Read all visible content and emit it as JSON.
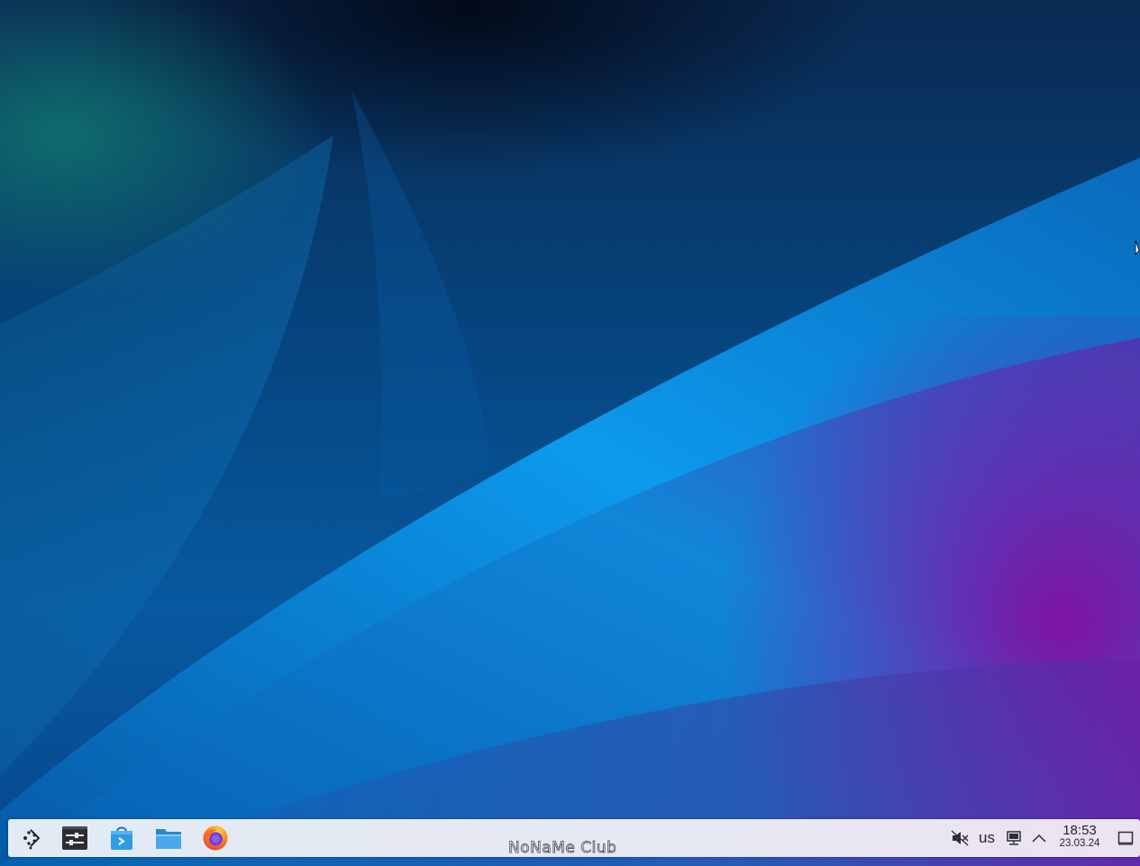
{
  "wallpaper": {
    "colors": {
      "deep_blue": "#0a2a52",
      "mid_blue": "#0759a0",
      "bright_blue": "#0d9ef2",
      "teal": "#10766e",
      "purple": "#800696"
    }
  },
  "panel": {
    "launchers": [
      {
        "name": "application-launcher",
        "icon": "kde-launcher-icon"
      },
      {
        "name": "system-settings",
        "icon": "settings-sliders-icon"
      },
      {
        "name": "discover",
        "icon": "shopping-bag-icon"
      },
      {
        "name": "dolphin",
        "icon": "folder-icon"
      },
      {
        "name": "firefox",
        "icon": "firefox-icon"
      }
    ],
    "watermark": "NoNaMe Club",
    "tray": {
      "volume_icon": "volume-muted-icon",
      "keyboard_layout": "us",
      "network_icon": "network-wired-icon",
      "expand_icon": "chevron-up-icon",
      "show_desktop_icon": "show-desktop-icon"
    },
    "clock": {
      "time": "18:53",
      "date": "23.03.24"
    }
  }
}
